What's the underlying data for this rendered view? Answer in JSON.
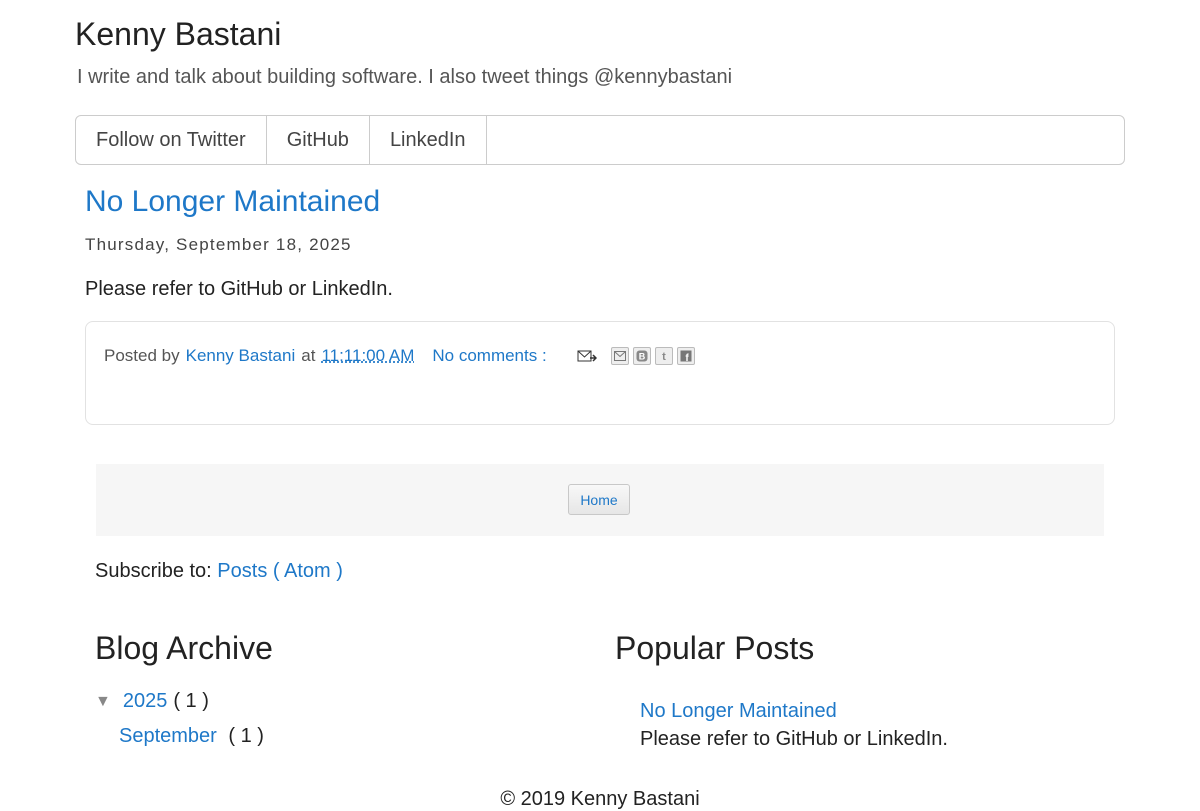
{
  "header": {
    "title": "Kenny Bastani",
    "description": "I write and talk about building software. I also tweet things @kennybastani"
  },
  "nav": {
    "items": [
      "Follow on Twitter",
      "GitHub",
      "LinkedIn"
    ]
  },
  "post": {
    "title": "No Longer Maintained",
    "date": "Thursday, September 18, 2025",
    "body": "Please refer to GitHub or LinkedIn.",
    "footer": {
      "posted_by_prefix": "Posted by",
      "author": "Kenny Bastani",
      "at": "at",
      "timestamp": "11:11:00 AM",
      "comments": "No comments :",
      "share_icons": [
        "email-post-icon",
        "email-this-icon",
        "blogthis-icon",
        "twitter-share-icon",
        "facebook-share-icon"
      ]
    }
  },
  "pager": {
    "home": "Home"
  },
  "subscribe": {
    "prefix": "Subscribe to:",
    "link": "Posts ( Atom )"
  },
  "archive": {
    "title": "Blog Archive",
    "toggle": "▼",
    "year": "2025",
    "year_count": "( 1 )",
    "month": "September",
    "month_count": "( 1 )"
  },
  "popular": {
    "title": "Popular Posts",
    "post_title": "No Longer Maintained",
    "post_snippet": "Please refer to GitHub or LinkedIn."
  },
  "footer": {
    "copyright": "© 2019 Kenny Bastani"
  },
  "colors": {
    "link": "#1e78c8",
    "text": "#222222",
    "muted": "#555555"
  }
}
